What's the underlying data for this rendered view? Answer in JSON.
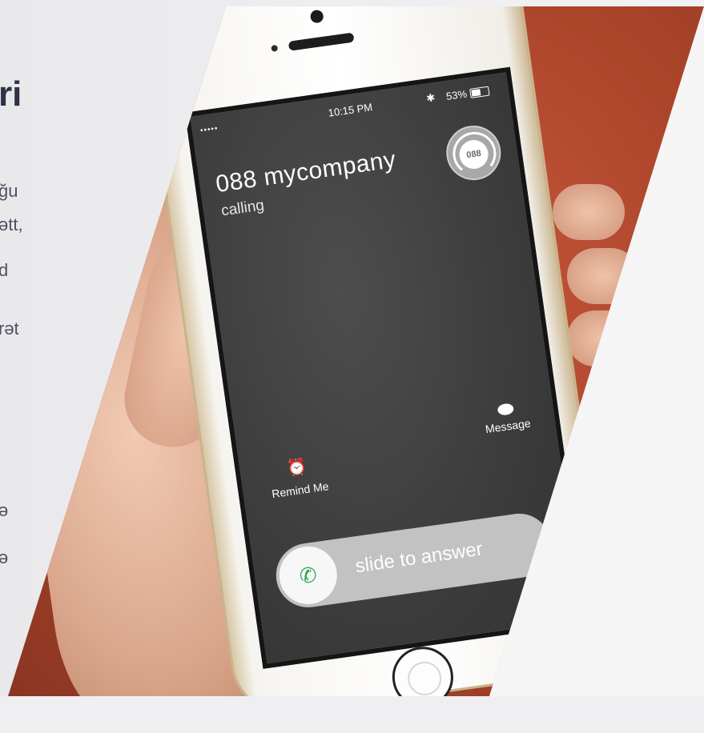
{
  "left_text": {
    "heading": "ri",
    "lines": [
      "ğu",
      "ətt,",
      "d",
      "rət",
      "ə",
      "ə"
    ]
  },
  "phone": {
    "status": {
      "signal": "•••••",
      "time": "10:15 PM",
      "battery": "53%",
      "bluetooth": "✱"
    },
    "caller": "088 mycompany",
    "calling": "calling",
    "avatar_label": "088",
    "actions": {
      "remind": "Remind Me",
      "message": "Message"
    },
    "slider_text": "slide to answer"
  },
  "colors": {
    "answer_green": "#2ca84a",
    "bg_red": "#a94429"
  },
  "icons": {
    "alarm": "alarm-clock-icon",
    "message": "speech-bubble-icon",
    "phone": "phone-handset-icon",
    "headset": "headset-icon",
    "bluetooth": "bluetooth-icon"
  }
}
